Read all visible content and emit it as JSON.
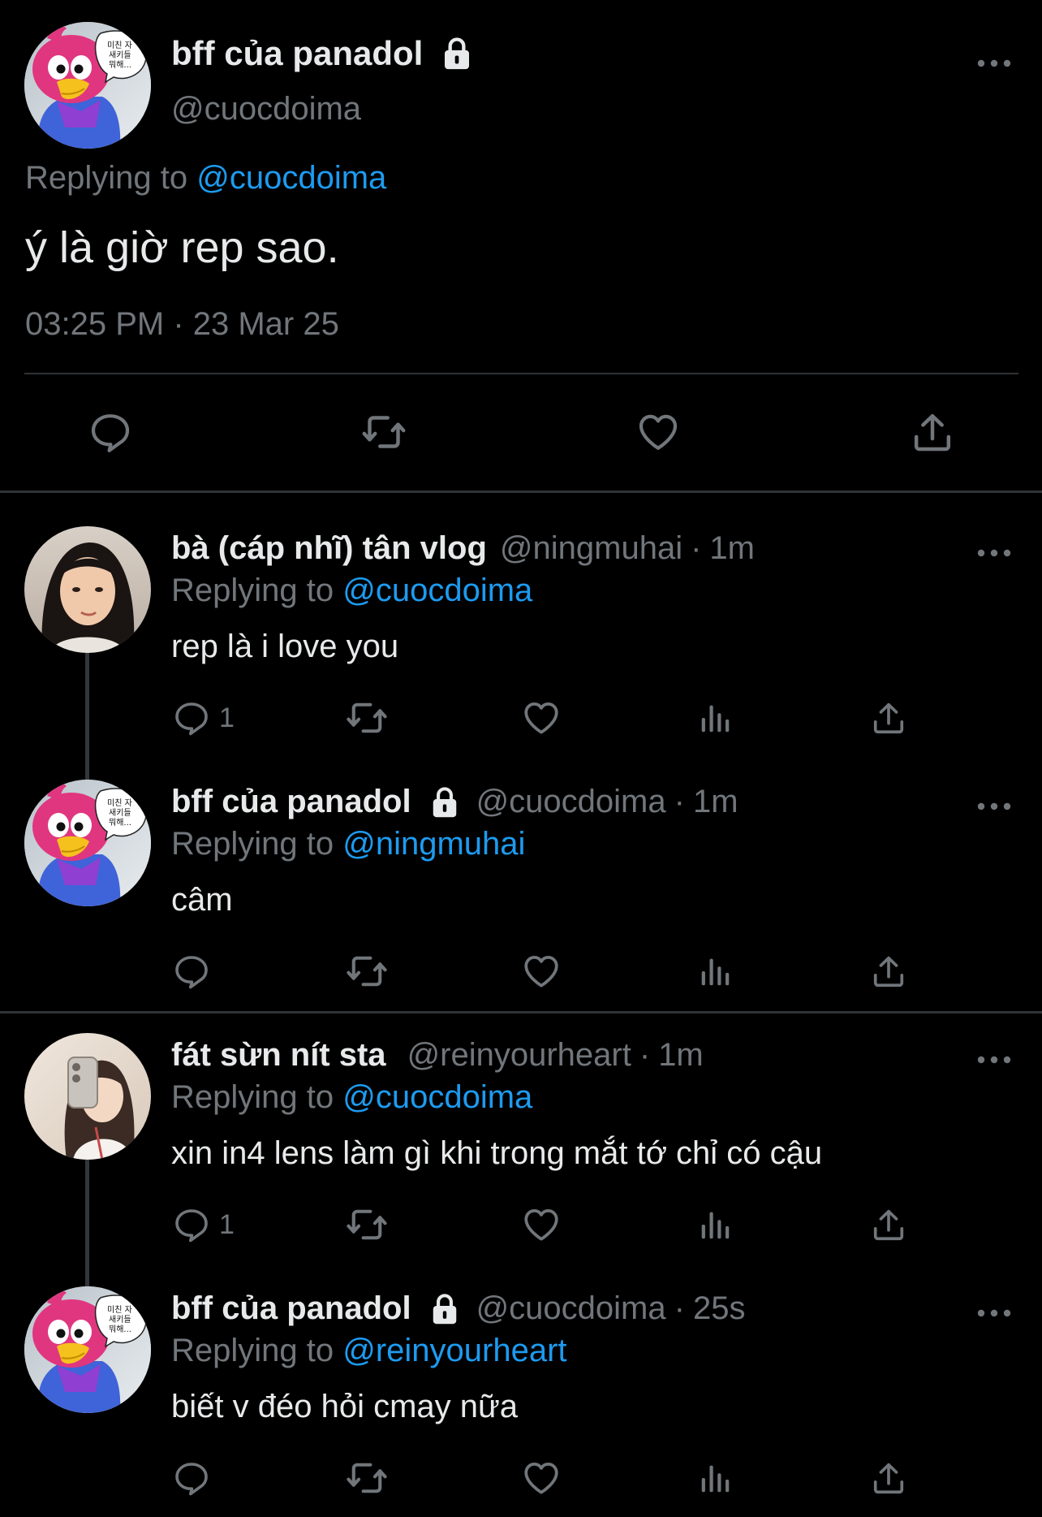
{
  "main_tweet": {
    "display_name": "bff của panadol",
    "handle": "@cuocdoima",
    "replying_prefix": "Replying to",
    "replying_to": "@cuocdoima",
    "text": "ý là giờ rep sao.",
    "timestamp": "03:25 PM · 23 Mar 25",
    "actions": [
      "reply-icon",
      "retweet-icon",
      "like-icon",
      "share-icon"
    ]
  },
  "replies": [
    {
      "display_name": "bà (cáp nhĩ) tân vlog",
      "handle": "@ningmuhai",
      "dot": "·",
      "time": "1m",
      "replying_prefix": "Replying to",
      "replying_to": "@cuocdoima",
      "text": "rep là i love you",
      "reply_count": "1",
      "locked": false
    },
    {
      "display_name": "bff của panadol",
      "handle": "@cuocdoima",
      "dot": "·",
      "time": "1m",
      "replying_prefix": "Replying to",
      "replying_to": "@ningmuhai",
      "text": "câm",
      "reply_count": "",
      "locked": true
    },
    {
      "display_name": "fát sừn nít sta",
      "handle": "@reinyourheart",
      "dot": "·",
      "time": "1m",
      "replying_prefix": "Replying to",
      "replying_to": "@cuocdoima",
      "text": "xin in4 lens làm gì khi trong mắt tớ chỉ có cậu",
      "reply_count": "1",
      "locked": false
    },
    {
      "display_name": "bff của panadol",
      "handle": "@cuocdoima",
      "dot": "·",
      "time": "25s",
      "replying_prefix": "Replying to",
      "replying_to": "@reinyourheart",
      "text": "biết v đéo hỏi cmay nữa",
      "reply_count": "",
      "locked": true
    }
  ],
  "avatar_speech_text": "미친 자\n새키들\n뭐해...",
  "colors": {
    "background": "#000000",
    "text_primary": "#e7e9ea",
    "text_secondary": "#71767b",
    "accent": "#1d9bf0",
    "divider": "#2f3336"
  }
}
